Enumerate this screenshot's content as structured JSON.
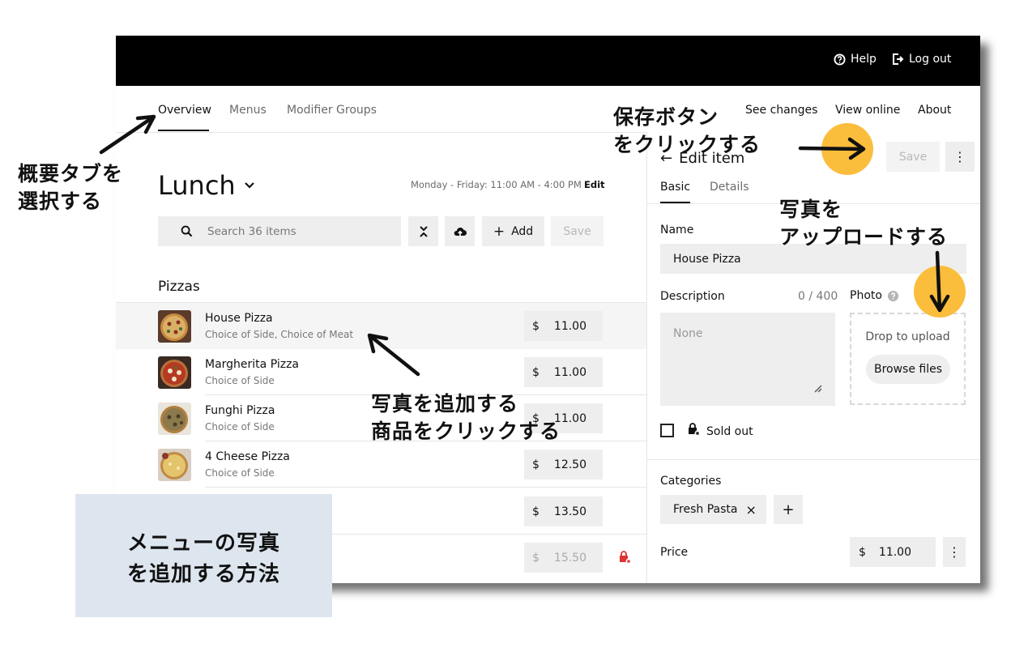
{
  "header": {
    "help": "Help",
    "logout": "Log out"
  },
  "nav": {
    "tabs": [
      "Overview",
      "Menus",
      "Modifier Groups"
    ],
    "right": [
      "See changes",
      "View online",
      "About"
    ]
  },
  "menu": {
    "title": "Lunch",
    "schedule": "Monday - Friday: 11:00 AM - 4:00 PM",
    "edit": "Edit",
    "search_placeholder": "Search 36 items",
    "add": "Add",
    "save": "Save",
    "section": "Pizzas",
    "items": [
      {
        "name": "House Pizza",
        "sub": "Choice of Side, Choice of Meat",
        "cur": "$",
        "price": "11.00"
      },
      {
        "name": "Margherita Pizza",
        "sub": "Choice of Side",
        "cur": "$",
        "price": "11.00"
      },
      {
        "name": "Funghi Pizza",
        "sub": "Choice of Side",
        "cur": "$",
        "price": "11.00"
      },
      {
        "name": "4 Cheese Pizza",
        "sub": "Choice of Side",
        "cur": "$",
        "price": "12.50"
      },
      {
        "name": "",
        "sub": "",
        "cur": "$",
        "price": "13.50"
      },
      {
        "name": "",
        "sub": "",
        "cur": "$",
        "price": "15.50"
      }
    ]
  },
  "panel": {
    "title": "Edit item",
    "save": "Save",
    "tabs": [
      "Basic",
      "Details"
    ],
    "name_label": "Name",
    "name_value": "House Pizza",
    "desc_label": "Description",
    "desc_count": "0 / 400",
    "desc_placeholder": "None",
    "photo_label": "Photo",
    "drop": "Drop to upload",
    "browse": "Browse files",
    "sold_out": "Sold out",
    "categories_label": "Categories",
    "category_chip": "Fresh Pasta",
    "price_label": "Price",
    "price_cur": "$",
    "price_value": "11.00"
  },
  "annotations": {
    "select_tab": [
      "概要タブを",
      "選択する"
    ],
    "click_save": [
      "保存ボタン",
      "をクリックする"
    ],
    "upload_photo": [
      "写真を",
      "アップロードする"
    ],
    "click_item": [
      "写真を追加する",
      "商品をクリックする"
    ],
    "title_box": [
      "メニューの写真",
      "を追加する方法"
    ]
  }
}
